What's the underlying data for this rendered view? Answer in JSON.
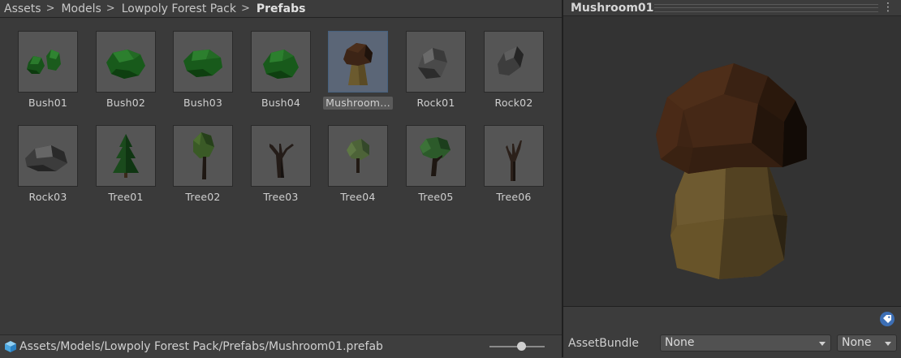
{
  "breadcrumb": [
    "Assets",
    "Models",
    "Lowpoly Forest Pack",
    "Prefabs"
  ],
  "assets": [
    {
      "name": "Bush01",
      "icon": "bush-icon",
      "selected": false
    },
    {
      "name": "Bush02",
      "icon": "bush-icon",
      "selected": false
    },
    {
      "name": "Bush03",
      "icon": "bush-icon",
      "selected": false
    },
    {
      "name": "Bush04",
      "icon": "bush-icon",
      "selected": false
    },
    {
      "name": "Mushroom…",
      "icon": "mushroom-icon",
      "selected": true
    },
    {
      "name": "Rock01",
      "icon": "rock-icon",
      "selected": false
    },
    {
      "name": "Rock02",
      "icon": "rock-icon",
      "selected": false
    },
    {
      "name": "Rock03",
      "icon": "rock-icon",
      "selected": false
    },
    {
      "name": "Tree01",
      "icon": "pine-tree-icon",
      "selected": false
    },
    {
      "name": "Tree02",
      "icon": "tree-icon",
      "selected": false
    },
    {
      "name": "Tree03",
      "icon": "dead-tree-icon",
      "selected": false
    },
    {
      "name": "Tree04",
      "icon": "tree-icon",
      "selected": false
    },
    {
      "name": "Tree05",
      "icon": "tree-icon",
      "selected": false
    },
    {
      "name": "Tree06",
      "icon": "dead-tree-icon",
      "selected": false
    }
  ],
  "status_path": "Assets/Models/Lowpoly Forest Pack/Prefabs/Mushroom01.prefab",
  "preview": {
    "title": "Mushroom01",
    "menu_glyph": "⋮"
  },
  "asset_bundle": {
    "label": "AssetBundle",
    "bundle_value": "None",
    "variant_value": "None"
  },
  "colors": {
    "selection": "#5b6677",
    "tag_icon": "#3d6fb5"
  }
}
